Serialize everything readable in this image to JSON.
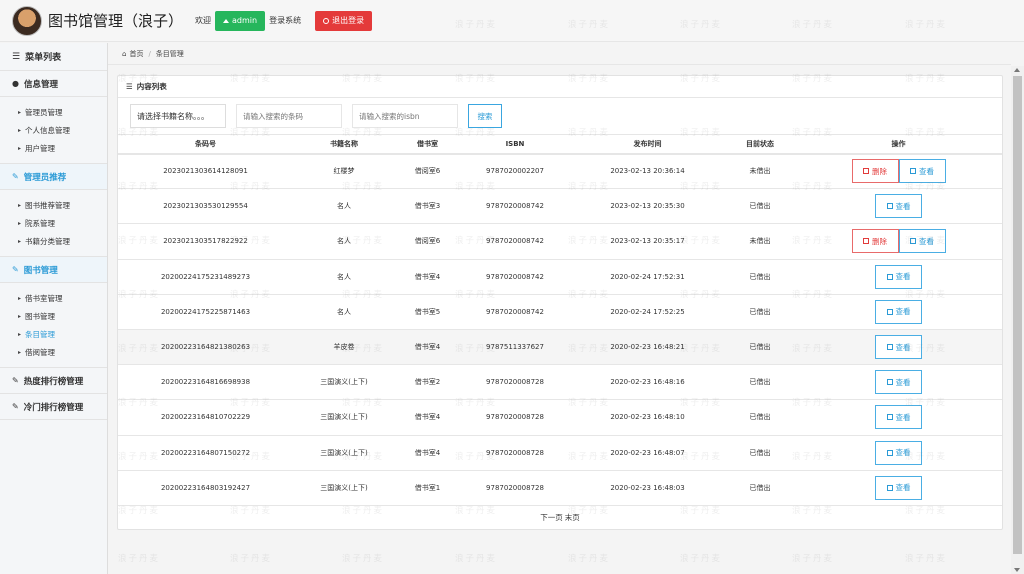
{
  "header": {
    "title": "图书馆管理（浪子）",
    "welcome": "欢迎",
    "admin_label": "admin",
    "login_text": "登录系统",
    "logout_label": "退出登录"
  },
  "sidebar": {
    "title": "菜单列表",
    "sections": [
      {
        "label": "信息管理",
        "items": [
          "管理员管理",
          "个人信息管理",
          "用户管理"
        ]
      },
      {
        "label": "管理员推荐",
        "items": [
          "图书推荐管理",
          "院系管理",
          "书籍分类管理"
        ]
      },
      {
        "label": "图书管理",
        "items": [
          "借书室管理",
          "图书管理",
          "条目管理",
          "借阅管理"
        ]
      },
      {
        "label": "热度排行榜管理"
      },
      {
        "label": "冷门排行榜管理"
      }
    ]
  },
  "breadcrumb": {
    "home": "首页",
    "current": "条目管理"
  },
  "panel": {
    "title": "内容列表"
  },
  "search": {
    "select_value": "请选择书籍名称。。。",
    "barcode_placeholder": "请输入搜索的条码",
    "isbn_placeholder": "请输入搜索的isbn",
    "button": "搜索"
  },
  "table": {
    "headers": [
      "条码号",
      "书籍名称",
      "借书室",
      "ISBN",
      "发布时间",
      "目前状态",
      "操作"
    ],
    "rows": [
      {
        "barcode": "20230213036141280​91",
        "name": "红楼梦",
        "room": "借阅室6",
        "isbn": "9787020002207",
        "time": "2023-02-13 20:36:14",
        "status": "未借出",
        "can_delete": true
      },
      {
        "barcode": "20230213035301295​54",
        "name": "名人",
        "room": "借书室3",
        "isbn": "9787020008742",
        "time": "2023-02-13 20:35:30",
        "status": "已借出",
        "can_delete": false
      },
      {
        "barcode": "20230213035178229​22",
        "name": "名人",
        "room": "借阅室6",
        "isbn": "9787020008742",
        "time": "2023-02-13 20:35:17",
        "status": "未借出",
        "can_delete": true
      },
      {
        "barcode": "20200224175231489​273",
        "name": "名人",
        "room": "借书室4",
        "isbn": "9787020008742",
        "time": "2020-02-24 17:52:31",
        "status": "已借出",
        "can_delete": false
      },
      {
        "barcode": "20200224175225871​463",
        "name": "名人",
        "room": "借书室5",
        "isbn": "9787020008742",
        "time": "2020-02-24 17:52:25",
        "status": "已借出",
        "can_delete": false
      },
      {
        "barcode": "20200223164821380​263",
        "name": "羊皮卷",
        "room": "借书室4",
        "isbn": "9787511337627",
        "time": "2020-02-23 16:48:21",
        "status": "已借出",
        "can_delete": false
      },
      {
        "barcode": "20200223164816698​938",
        "name": "三国演义(上下)",
        "room": "借书室2",
        "isbn": "9787020008728",
        "time": "2020-02-23 16:48:16",
        "status": "已借出",
        "can_delete": false
      },
      {
        "barcode": "20200223164810702​229",
        "name": "三国演义(上下)",
        "room": "借书室4",
        "isbn": "9787020008728",
        "time": "2020-02-23 16:48:10",
        "status": "已借出",
        "can_delete": false
      },
      {
        "barcode": "20200223164807150​272",
        "name": "三国演义(上下)",
        "room": "借书室4",
        "isbn": "9787020008728",
        "time": "2020-02-23 16:48:07",
        "status": "已借出",
        "can_delete": false
      },
      {
        "barcode": "20200223164803192​427",
        "name": "三国演义(上下)",
        "room": "借书室1",
        "isbn": "9787020008728",
        "time": "2020-02-23 16:48:03",
        "status": "已借出",
        "can_delete": false
      }
    ],
    "delete_label": "删除",
    "view_label": "查看"
  },
  "pager": {
    "next": "下一页",
    "last": "末页"
  },
  "watermark": "浪子丹麦"
}
